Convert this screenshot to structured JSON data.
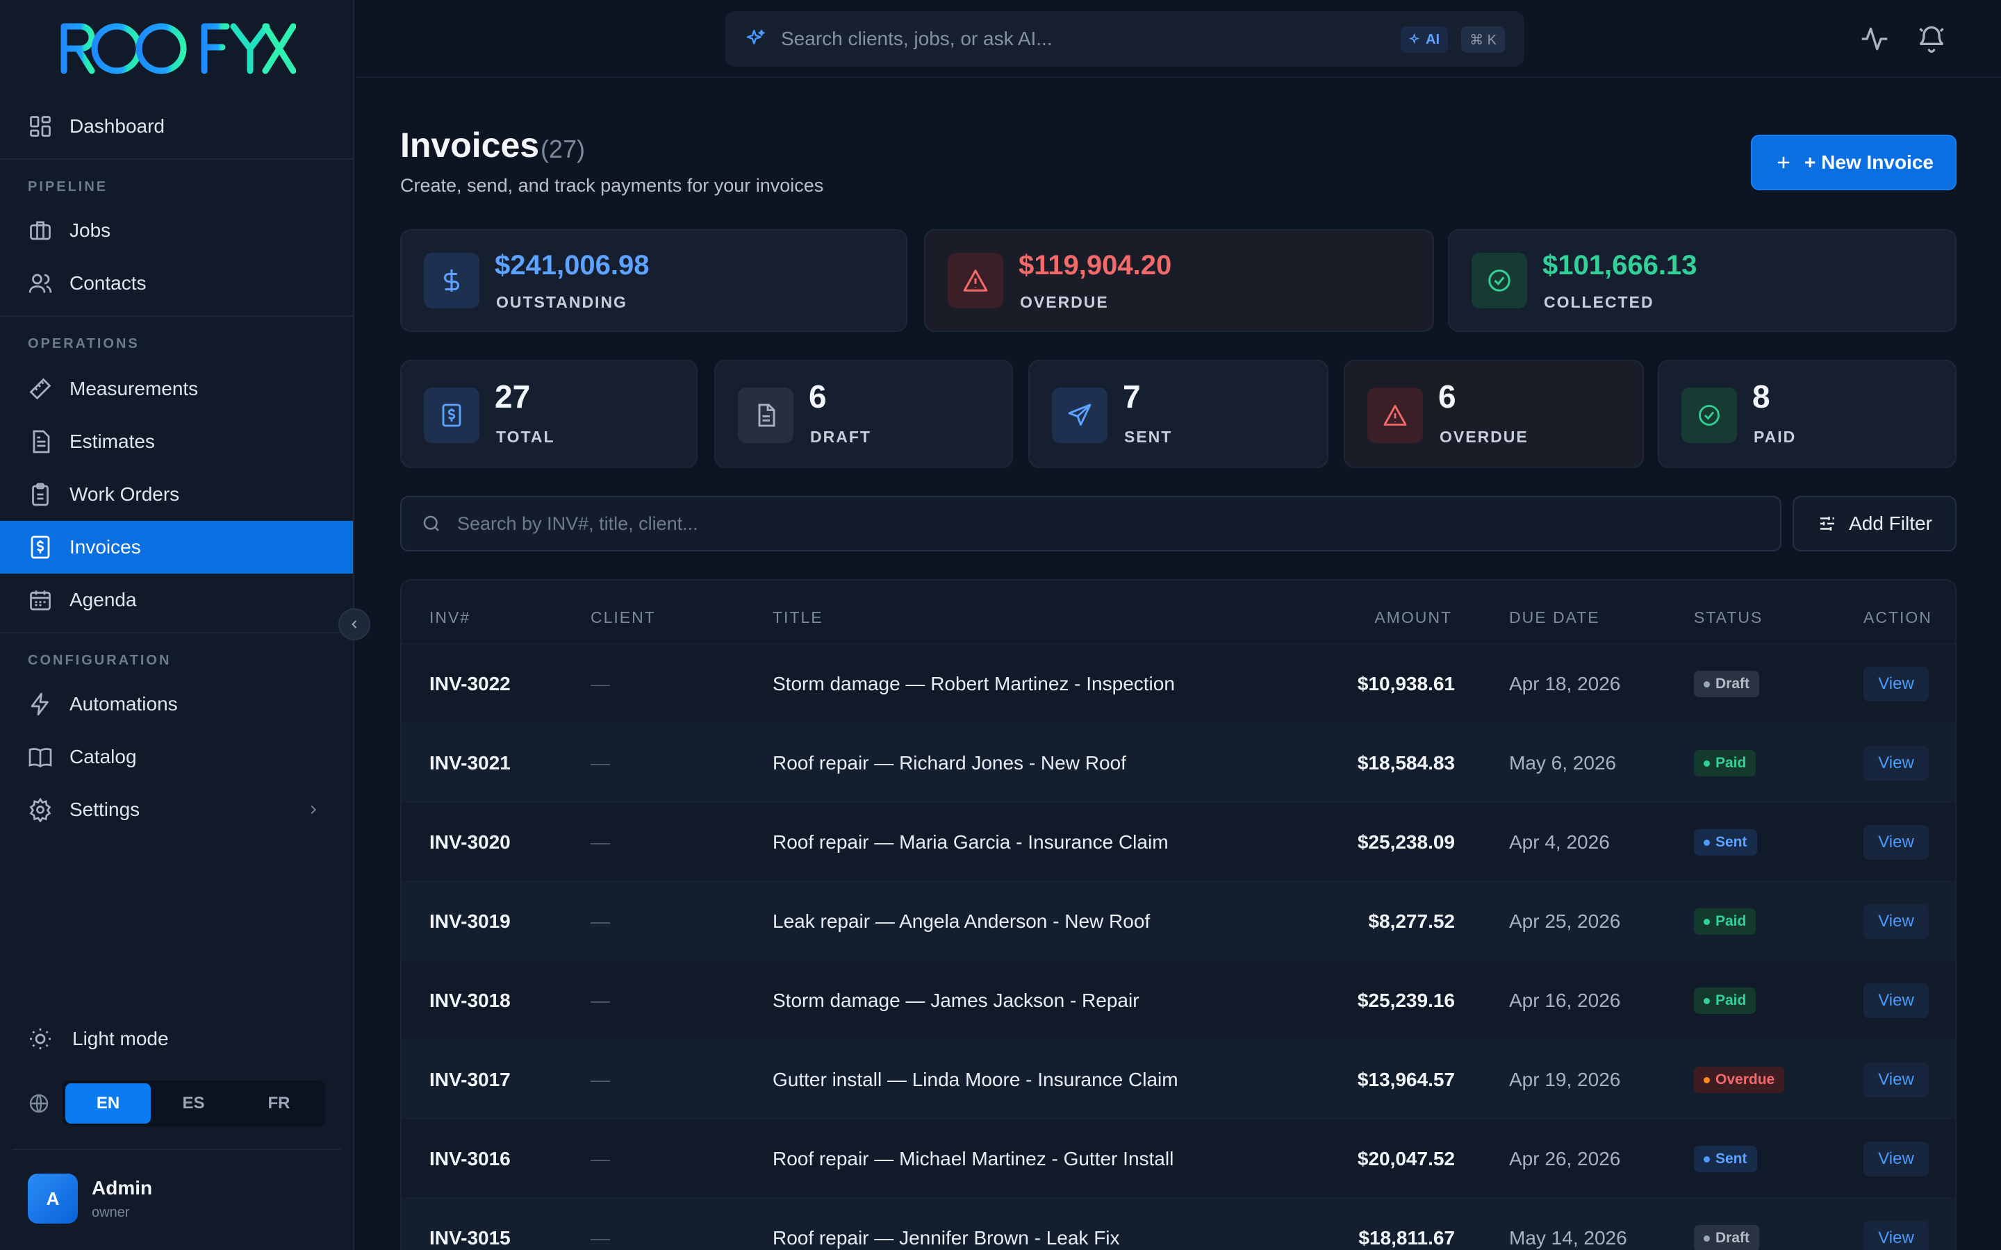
{
  "app": {
    "logo_text": "ROOFYX"
  },
  "sidebar": {
    "dashboard": "Dashboard",
    "sections": {
      "pipeline": "PIPELINE",
      "operations": "OPERATIONS",
      "configuration": "CONFIGURATION"
    },
    "items": {
      "jobs": "Jobs",
      "contacts": "Contacts",
      "measurements": "Measurements",
      "estimates": "Estimates",
      "work_orders": "Work Orders",
      "invoices": "Invoices",
      "agenda": "Agenda",
      "automations": "Automations",
      "catalog": "Catalog",
      "settings": "Settings"
    },
    "active_item": "Invoices",
    "light_mode": "Light mode",
    "languages": [
      "EN",
      "ES",
      "FR"
    ],
    "active_language": "EN",
    "user": {
      "initial": "A",
      "name": "Admin",
      "role": "owner"
    }
  },
  "topbar": {
    "search_placeholder": "Search clients, jobs, or ask AI...",
    "ai_badge": "AI",
    "shortcut": "⌘ K"
  },
  "header": {
    "title": "Invoices",
    "count": "(27)",
    "subtitle": "Create, send, and track payments for your invoices",
    "new_button": "+ New Invoice"
  },
  "summary": {
    "outstanding": {
      "value": "$241,006.98",
      "label": "OUTSTANDING",
      "color": "#5ea3ff"
    },
    "overdue": {
      "value": "$119,904.20",
      "label": "OVERDUE",
      "color": "#f26a6a"
    },
    "collected": {
      "value": "$101,666.13",
      "label": "COLLECTED",
      "color": "#33d198"
    }
  },
  "counts": {
    "total": {
      "value": "27",
      "label": "TOTAL"
    },
    "draft": {
      "value": "6",
      "label": "DRAFT"
    },
    "sent": {
      "value": "7",
      "label": "SENT"
    },
    "overdue": {
      "value": "6",
      "label": "OVERDUE"
    },
    "paid": {
      "value": "8",
      "label": "PAID"
    }
  },
  "filters": {
    "search_placeholder": "Search by INV#, title, client...",
    "add_filter": "Add Filter"
  },
  "table": {
    "columns": {
      "inv": "INV#",
      "client": "CLIENT",
      "title": "TITLE",
      "amount": "AMOUNT",
      "due": "DUE DATE",
      "status": "STATUS",
      "action": "ACTION"
    },
    "rows": [
      {
        "inv": "INV-3022",
        "client": "—",
        "title": "Storm damage — Robert Martinez - Inspection",
        "amount": "$10,938.61",
        "due": "Apr 18, 2026",
        "status": "Draft",
        "action": "View"
      },
      {
        "inv": "INV-3021",
        "client": "—",
        "title": "Roof repair — Richard Jones - New Roof",
        "amount": "$18,584.83",
        "due": "May 6, 2026",
        "status": "Paid",
        "action": "View"
      },
      {
        "inv": "INV-3020",
        "client": "—",
        "title": "Roof repair — Maria Garcia - Insurance Claim",
        "amount": "$25,238.09",
        "due": "Apr 4, 2026",
        "status": "Sent",
        "action": "View"
      },
      {
        "inv": "INV-3019",
        "client": "—",
        "title": "Leak repair — Angela Anderson - New Roof",
        "amount": "$8,277.52",
        "due": "Apr 25, 2026",
        "status": "Paid",
        "action": "View"
      },
      {
        "inv": "INV-3018",
        "client": "—",
        "title": "Storm damage — James Jackson - Repair",
        "amount": "$25,239.16",
        "due": "Apr 16, 2026",
        "status": "Paid",
        "action": "View"
      },
      {
        "inv": "INV-3017",
        "client": "—",
        "title": "Gutter install — Linda Moore - Insurance Claim",
        "amount": "$13,964.57",
        "due": "Apr 19, 2026",
        "status": "Overdue",
        "action": "View"
      },
      {
        "inv": "INV-3016",
        "client": "—",
        "title": "Roof repair — Michael Martinez - Gutter Install",
        "amount": "$20,047.52",
        "due": "Apr 26, 2026",
        "status": "Sent",
        "action": "View"
      },
      {
        "inv": "INV-3015",
        "client": "—",
        "title": "Roof repair — Jennifer Brown - Leak Fix",
        "amount": "$18,811.67",
        "due": "May 14, 2026",
        "status": "Draft",
        "action": "View"
      }
    ]
  },
  "status_colors": {
    "Draft": {
      "bg": "#2a3342",
      "fg": "#b3bcc9",
      "dot": "#9aa5b5"
    },
    "Paid": {
      "bg": "#143a2e",
      "fg": "#33d198",
      "dot": "#33d198"
    },
    "Sent": {
      "bg": "#172b4a",
      "fg": "#5ea3ff",
      "dot": "#4a9bff"
    },
    "Overdue": {
      "bg": "#3d1c22",
      "fg": "#f26a6a",
      "dot": "#ff8a1f"
    }
  },
  "icons": {
    "dashboard": "grid-icon",
    "jobs": "briefcase-icon",
    "contacts": "users-icon",
    "measurements": "ruler-icon",
    "estimates": "document-icon",
    "work_orders": "clipboard-icon",
    "invoices": "receipt-dollar-icon",
    "agenda": "calendar-icon",
    "automations": "lightning-icon",
    "catalog": "book-icon",
    "settings": "gear-icon"
  }
}
